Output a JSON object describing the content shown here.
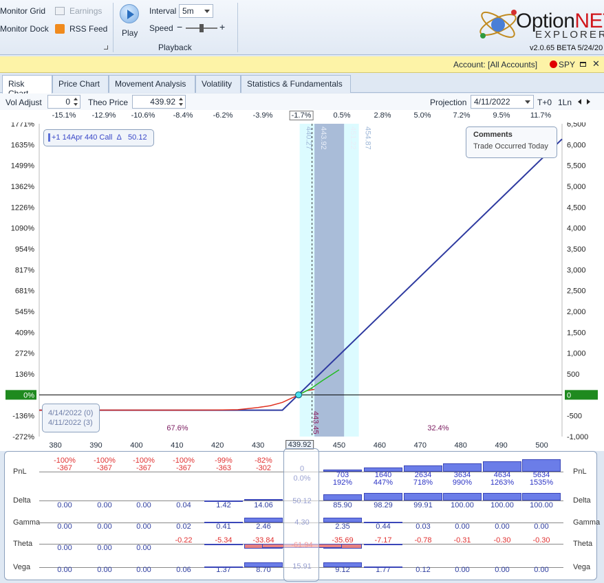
{
  "ribbon": {
    "monitor_grid": "Monitor Grid",
    "monitor_dock": "Monitor Dock",
    "earnings": "Earnings",
    "rss_feed": "RSS Feed",
    "play": "Play",
    "interval_label": "Interval",
    "interval_value": "5m",
    "speed_label": "Speed",
    "speed_minus": "−",
    "speed_plus": "+",
    "speed_level": 0.5,
    "group_playback": "Playback"
  },
  "logo": {
    "name_a": "Option",
    "name_b": "NET",
    "sub": "EXPLORER",
    "version": "v2.0.65 BETA 5/24/20"
  },
  "account_bar": {
    "label": "Account: [All Accounts]",
    "symbol": "SPY",
    "status_color": "#e00000"
  },
  "tabs": [
    "Risk Chart",
    "Price Chart",
    "Movement Analysis",
    "Volatility",
    "Statistics & Fundamentals"
  ],
  "controls": {
    "vol_adjust_label": "Vol Adjust",
    "vol_adjust_value": "0",
    "theo_price_label": "Theo Price",
    "theo_price_value": "439.92",
    "projection_label": "Projection",
    "projection_value": "4/11/2022",
    "t_plus": "T+0",
    "lines": "1Ln"
  },
  "pct_labels": [
    "-15.1%",
    "-12.9%",
    "-10.6%",
    "-8.4%",
    "-6.2%",
    "-3.9%",
    "-1.7%",
    "0.5%",
    "2.8%",
    "5.0%",
    "7.2%",
    "9.5%",
    "11.7%"
  ],
  "legend": {
    "position": "+1 14Apr 440 Call",
    "delta_symbol": "Δ",
    "delta_value": "50.12"
  },
  "comments": {
    "title": "Comments",
    "text": "Trade Occurred Today"
  },
  "dates": {
    "d1": "4/14/2022 (0)",
    "d2": "4/11/2022 (3)"
  },
  "probs": {
    "left": "67.6%",
    "right": "32.4%"
  },
  "vert_labels": {
    "v1": "440.27",
    "v2": "443.92",
    "v3": "451.22",
    "v4": "454.87",
    "breakeven": "443.45"
  },
  "left_axis": [
    "1771%",
    "1635%",
    "1499%",
    "1362%",
    "1226%",
    "1090%",
    "954%",
    "817%",
    "681%",
    "545%",
    "409%",
    "272%",
    "136%",
    "0%",
    "-136%",
    "-272%"
  ],
  "right_axis": [
    "6,500",
    "6,000",
    "5,500",
    "5,000",
    "4,500",
    "4,000",
    "3,500",
    "3,000",
    "2,500",
    "2,000",
    "1,500",
    "1,000",
    "500",
    "0",
    "-500",
    "-1,000"
  ],
  "chart_data": {
    "type": "line",
    "xlabel": "",
    "ylabel": "",
    "x_ticks": [
      380,
      390,
      400,
      410,
      420,
      430,
      440,
      450,
      460,
      470,
      480,
      490,
      500
    ],
    "xlim": [
      376,
      505
    ],
    "ylim": [
      -1000,
      6500
    ],
    "current_price": "439.92",
    "series": [
      {
        "x": [
          376,
          436,
          505
        ],
        "y": [
          -367,
          -367,
          6133
        ]
      },
      {
        "x": [
          376,
          420,
          425,
          430,
          433,
          436,
          440,
          442,
          443.92
        ],
        "y": [
          -367,
          -363,
          -355,
          -302,
          -260,
          -180,
          0,
          100,
          130
        ]
      },
      {
        "x": [
          440,
          443,
          446,
          450
        ],
        "y": [
          0,
          150,
          350,
          600
        ]
      }
    ]
  },
  "greeks": {
    "cols_x": [
      93,
      151,
      208,
      266,
      324,
      382,
      497,
      556,
      614,
      671,
      729,
      786
    ],
    "pnl": {
      "label": "PnL",
      "top": [
        "-100%",
        "-100%",
        "-100%",
        "-100%",
        "-99%",
        "-82%",
        "703",
        "1640",
        "2634",
        "3634",
        "4634",
        "5634"
      ],
      "bottom": [
        "-367",
        "-367",
        "-367",
        "-367",
        "-363",
        "-302",
        "192%",
        "447%",
        "718%",
        "990%",
        "1263%",
        "1535%"
      ],
      "center_top": "0",
      "center_bottom": "0.0%"
    },
    "delta": {
      "label": "Delta",
      "values": [
        "0.00",
        "0.00",
        "0.00",
        "0.04",
        "1.42",
        "14.06",
        "85.90",
        "98.29",
        "99.91",
        "100.00",
        "100.00",
        "100.00"
      ],
      "center": "50.12"
    },
    "gamma": {
      "label": "Gamma",
      "values": [
        "0.00",
        "0.00",
        "0.00",
        "0.02",
        "0.41",
        "2.46",
        "2.35",
        "0.44",
        "0.03",
        "0.00",
        "0.00",
        "0.00"
      ],
      "center": "4.30"
    },
    "theta": {
      "label": "Theta",
      "top": [
        "",
        "",
        "",
        "-0.22",
        "-5.34",
        "-33.84",
        "-35.69",
        "-7.17",
        "-0.78",
        "-0.31",
        "-0.30",
        "-0.30"
      ],
      "bottom": [
        "0.00",
        "0.00",
        "0.00",
        "",
        "",
        "",
        "",
        "",
        "",
        "",
        "",
        ""
      ],
      "center": "-61.94"
    },
    "vega": {
      "label": "Vega",
      "values": [
        "0.00",
        "0.00",
        "0.00",
        "0.06",
        "1.37",
        "8.70",
        "9.12",
        "1.77",
        "0.12",
        "0.00",
        "0.00",
        "0.00"
      ],
      "center": "15.91"
    }
  }
}
